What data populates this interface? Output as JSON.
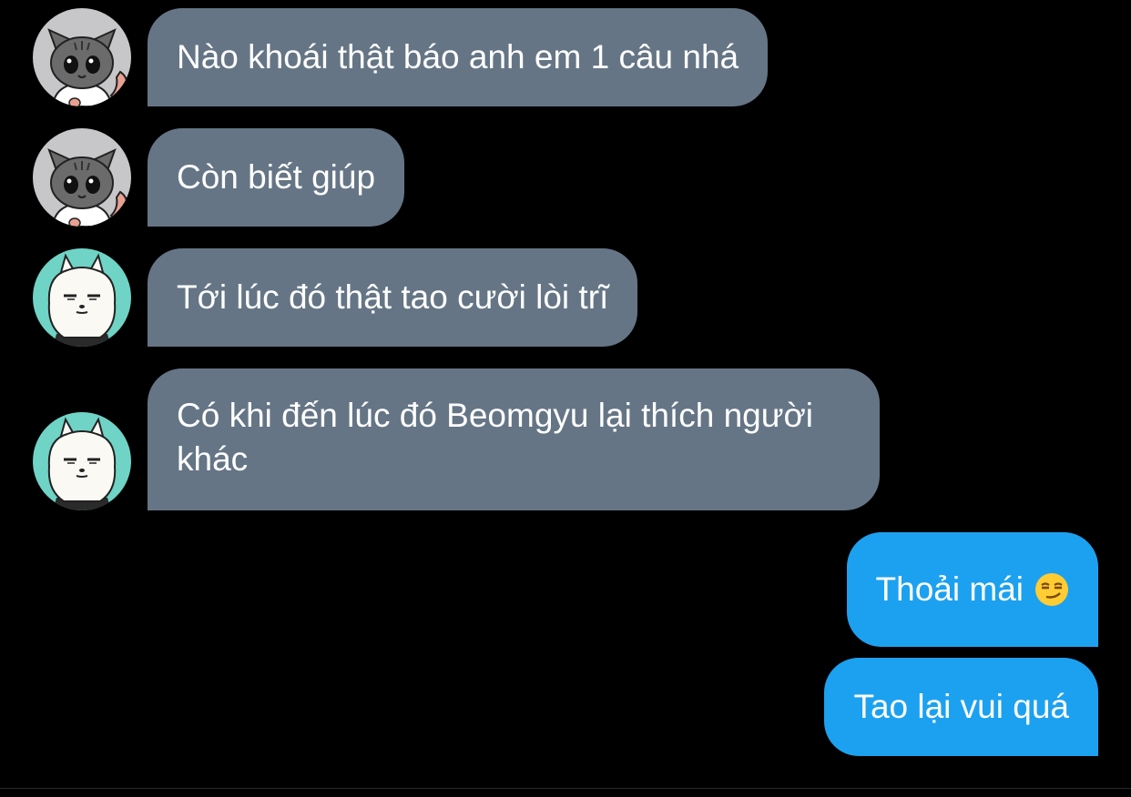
{
  "colors": {
    "background": "#000000",
    "incoming_bubble": "#657585",
    "outgoing_bubble": "#1ca1f0",
    "text": "#ffffff"
  },
  "messages": [
    {
      "direction": "incoming",
      "avatar": "gray-tabby-cat-avatar",
      "text": "Nào khoái thật báo anh em 1 câu nhá"
    },
    {
      "direction": "incoming",
      "avatar": "gray-tabby-cat-avatar",
      "text": "Còn biết giúp"
    },
    {
      "direction": "incoming",
      "avatar": "white-fluffy-dog-avatar",
      "text": "Tới lúc đó thật tao cười lòi trĩ"
    },
    {
      "direction": "incoming",
      "avatar": "white-fluffy-dog-avatar",
      "text": "Có khi đến lúc đó Beomgyu lại thích người khác"
    },
    {
      "direction": "outgoing",
      "text": "Thoải mái",
      "emoji": "smirking-face-emoji"
    },
    {
      "direction": "outgoing",
      "text": "Tao lại vui quá"
    }
  ]
}
